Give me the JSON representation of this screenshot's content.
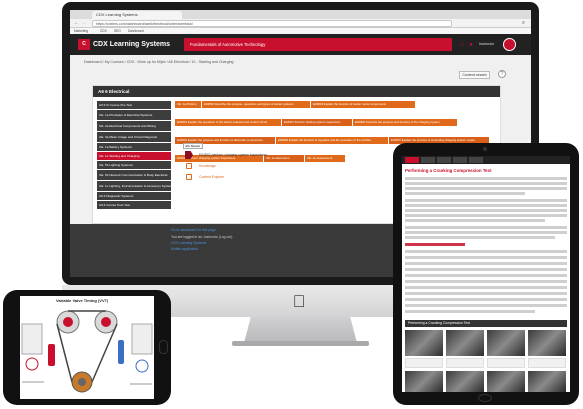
{
  "browser": {
    "tab_label": "CDX Learning Systems",
    "url": "https://cdxlms.com/dashboard/ase6/electrical/cdxmastertask/",
    "bookmarks": [
      "Marketing",
      "CDX",
      "SEO",
      "Dashboard"
    ]
  },
  "header": {
    "app_title": "CDX Learning Systems",
    "course_title": "Fundamentals of Automotive Technology",
    "user_name": "Instructor"
  },
  "breadcrumb": "Dashboard / My Courses / CDX - Work up for Mijee / A6 Electrical / 10 - Starting and Charging",
  "content_search_label": "Content search",
  "panel_title": "A6 6 Electrical",
  "sidebar_items": [
    {
      "label": "A6 6 Ib Course Pre-Test",
      "active": false
    },
    {
      "label": "CE. 1a Principles of Electrical Systems",
      "active": false
    },
    {
      "label": "CE. 2a Electrical Components and Wiring",
      "active": false
    },
    {
      "label": "CE. 3a Meter Usage and Circuit Diagnosis",
      "active": false
    },
    {
      "label": "CE. 1a Battery Systems",
      "active": false
    },
    {
      "label": "CE. 1e Starting and Charging",
      "active": true
    },
    {
      "label": "CE. 5b Lighting Systems",
      "active": false
    },
    {
      "label": "CE. 6b Network Communication & Body Electrical",
      "active": false
    },
    {
      "label": "CE. 1c Lighting, Instrumentation & Accessory Systems",
      "active": false
    },
    {
      "label": "A6 6 Diagnostic Systems",
      "active": false
    },
    {
      "label": "A6 6 Course Post-Test",
      "active": false
    }
  ],
  "task_tags": [
    "CE. 1a Prelims",
    "E04802 Describe the purpose, operation, and types of starter systems",
    "E04803 Explain the function of starter motor components",
    "E04804 Explain the operation of the starter solenoid and control circuit",
    "E04807 Perform starting system inspections",
    "E04806 Describe the purpose and function of the charging system",
    "E04804 Explain the purpose and function of alternator components",
    "E04806 Explain the function of regulator and the operation of the rectifier",
    "E04807 Explain the process of controlling charging system output",
    "E04814 Perform charging system inspections",
    "CE. 1e Alternators",
    "CE. 1e Assessment"
  ],
  "sub_tab": "Job Sheets",
  "job_sheets": [
    "E04802 perform charging system inspections",
    "Knowledge",
    "Content Explorer"
  ],
  "footer": {
    "line1": "Go to dashboard for this page",
    "line2": "You are logged in as: Instructor (Log out)",
    "line3": "CDX Learning Systems",
    "line4": "Mobile application"
  },
  "tablet": {
    "title": "Performing a Cranking Compression Test",
    "figure_title": "Performing a Cranking Compression Test"
  },
  "phone": {
    "title": "Variable Valve Timing (VVT)"
  },
  "colors": {
    "brand_red": "#c8102e",
    "task_orange": "#e06a1a",
    "dark": "#222222"
  }
}
